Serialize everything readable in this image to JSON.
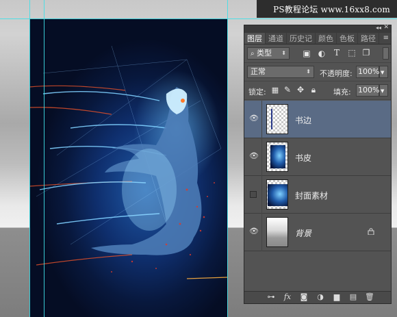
{
  "watermark": "PS教程论坛 www.16xx8.com",
  "layers_panel": {
    "tabs": [
      {
        "label": "图层",
        "active": true
      },
      {
        "label": "通道",
        "active": false
      },
      {
        "label": "历史记",
        "active": false
      },
      {
        "label": "颜色",
        "active": false
      },
      {
        "label": "色板",
        "active": false
      },
      {
        "label": "路径",
        "active": false
      }
    ],
    "filter": {
      "type_label": "类型"
    },
    "blend_mode": "正常",
    "opacity": {
      "label": "不透明度:",
      "value": "100%"
    },
    "lock": {
      "label": "锁定:"
    },
    "fill": {
      "label": "填充:",
      "value": "100%"
    },
    "layers": [
      {
        "name": "书边",
        "visible": true,
        "selected": true,
        "thumb": "transparent-with-line"
      },
      {
        "name": "书皮",
        "visible": true,
        "selected": false,
        "thumb": "cover-art"
      },
      {
        "name": "封面素材",
        "visible": false,
        "selected": false,
        "thumb": "cover-art"
      },
      {
        "name": "背景",
        "visible": true,
        "selected": false,
        "thumb": "gray-gradient",
        "locked": true
      }
    ]
  },
  "colors": {
    "guide": "#3fe0e8",
    "panel_bg": "#535353",
    "selected_layer": "#5a6b85",
    "art_core": "#1f5aa8",
    "art_glow": "#7fd0ff",
    "art_accent": "#e0502a"
  }
}
